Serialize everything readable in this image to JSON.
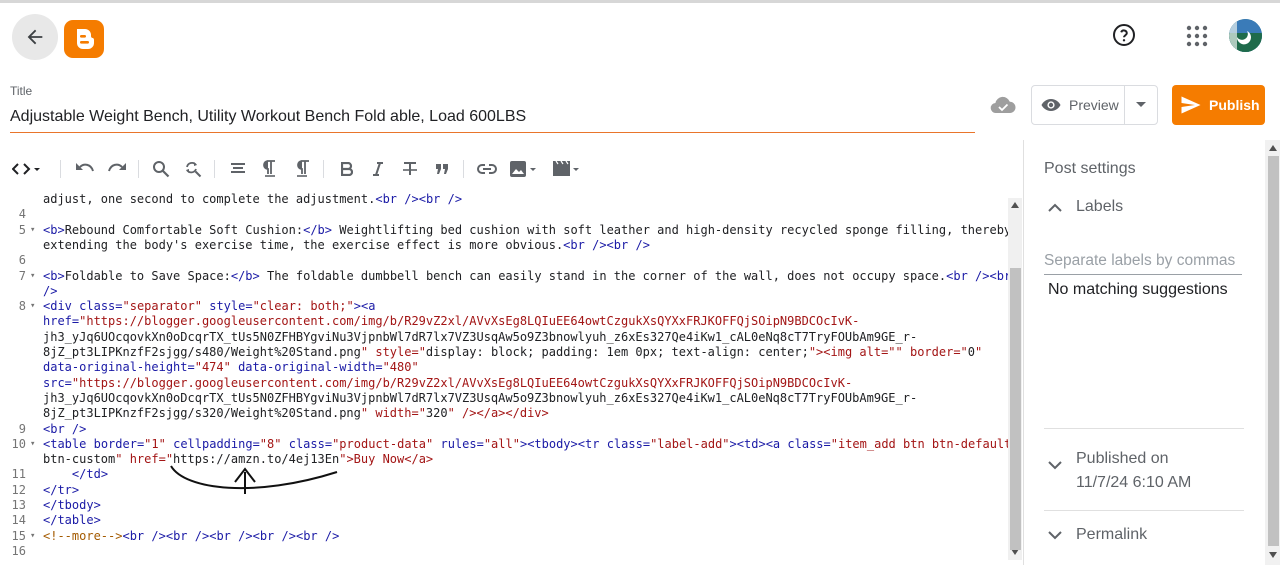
{
  "header": {
    "back_icon": "arrow-left-icon",
    "logo_icon": "blogger-logo",
    "help_icon": "help-circle-icon",
    "apps_icon": "apps-grid-icon",
    "avatar_icon": "user-avatar"
  },
  "post": {
    "title_label": "Title",
    "title_value": "Adjustable Weight Bench, Utility Workout Bench Fold able, Load 600LBS"
  },
  "actions": {
    "preview_label": "Preview",
    "publish_label": "Publish",
    "accent_color": "#f57c00"
  },
  "toolbar": {
    "items": [
      "code-view-icon",
      "undo-icon",
      "redo-icon",
      "search-icon",
      "find-replace-icon",
      "align-icon",
      "paragraph-ltr-icon",
      "paragraph-rtl-icon",
      "bold-icon",
      "italic-icon",
      "strikethrough-icon",
      "quote-icon",
      "link-icon",
      "image-icon",
      "video-icon"
    ]
  },
  "editor": {
    "lines": [
      {
        "n": "",
        "text": "adjust, one second to complete the adjustment.<br /><br />"
      },
      {
        "n": "4",
        "text": ""
      },
      {
        "n": "5",
        "fold": true,
        "text": "<b>Rebound Comfortable Soft Cushion:</b> Weightlifting bed cushion with soft leather and high-density recycled sponge filling, thereby"
      },
      {
        "n": "",
        "text": "extending the body's exercise time, the exercise effect is more obvious.<br /><br />"
      },
      {
        "n": "6",
        "text": ""
      },
      {
        "n": "7",
        "fold": true,
        "text": "<b>Foldable to Save Space:</b> The foldable dumbbell bench can easily stand in the corner of the wall, does not occupy space.<br /><br"
      },
      {
        "n": "",
        "text": "/>"
      },
      {
        "n": "8",
        "fold": true,
        "text": "<div class=\"separator\" style=\"clear: both;\"><a"
      },
      {
        "n": "",
        "text": "href=\"https://blogger.googleusercontent.com/img/b/R29vZ2xl/AVvXsEg8LQIuEE64owtCzgukXsQYXxFRJKOFFQjSOipN9BDCOcIvK-"
      },
      {
        "n": "",
        "text": "jh3_yJq6UOcqovkXn0oDcqrTX_tUs5N0ZFHBYgviNu3VjpnbWl7dR7lx7VZ3UsqAw5o9Z3bnowlyuh_z6xEs327Qe4iKw1_cAL0eNq8cT7TryFOUbAm9GE_r-"
      },
      {
        "n": "",
        "text": "8jZ_pt3LIPKnzfF2sjgg/s480/Weight%20Stand.png\" style=\"display: block; padding: 1em 0px; text-align: center;\"><img alt=\"\" border=\"0\""
      },
      {
        "n": "",
        "text": "data-original-height=\"474\" data-original-width=\"480\""
      },
      {
        "n": "",
        "text": "src=\"https://blogger.googleusercontent.com/img/b/R29vZ2xl/AVvXsEg8LQIuEE64owtCzgukXsQYXxFRJKOFFQjSOipN9BDCOcIvK-"
      },
      {
        "n": "",
        "text": "jh3_yJq6UOcqovkXn0oDcqrTX_tUs5N0ZFHBYgviNu3VjpnbWl7dR7lx7VZ3UsqAw5o9Z3bnowlyuh_z6xEs327Qe4iKw1_cAL0eNq8cT7TryFOUbAm9GE_r-"
      },
      {
        "n": "",
        "text": "8jZ_pt3LIPKnzfF2sjgg/s320/Weight%20Stand.png\" width=\"320\" /></a></div>"
      },
      {
        "n": "9",
        "text": "<br />"
      },
      {
        "n": "10",
        "fold": true,
        "text": "<table border=\"1\" cellpadding=\"8\" class=\"product-data\" rules=\"all\"><tbody><tr class=\"label-add\"><td><a class=\"item_add btn btn-default"
      },
      {
        "n": "",
        "text": "btn-custom\" href=\"https://amzn.to/4ej13En\">Buy Now</a>"
      },
      {
        "n": "11",
        "text": "    </td>"
      },
      {
        "n": "12",
        "text": "</tr>"
      },
      {
        "n": "13",
        "text": "</tbody>"
      },
      {
        "n": "14",
        "text": "</table>"
      },
      {
        "n": "15",
        "fold": true,
        "text": "<!--more--><br /><br /><br /><br /><br />"
      },
      {
        "n": "16",
        "text": ""
      }
    ],
    "highlight": "https://amzn.to/4ej13En",
    "highlight_color": "#ffff57"
  },
  "sidebar": {
    "title": "Post settings",
    "labels_heading": "Labels",
    "labels_placeholder": "Separate labels by commas",
    "labels_suggestion": "No matching suggestions",
    "published_on_label": "Published on",
    "published_on_value": "11/7/24 6:10 AM",
    "permalink_label": "Permalink"
  }
}
